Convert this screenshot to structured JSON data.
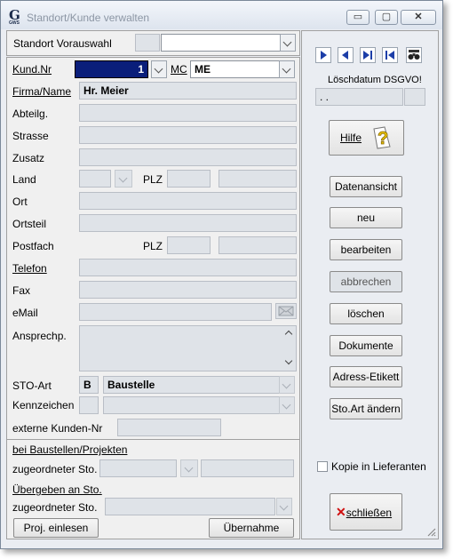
{
  "window": {
    "title": "Standort/Kunde verwalten",
    "app_logo": "G",
    "app_logo_sub": "GWS",
    "minimize_glyph": "▭",
    "maximize_glyph": "▢",
    "close_glyph": "✕"
  },
  "top": {
    "standort_label": "Standort Vorauswahl",
    "standort_code": "",
    "standort_value": ""
  },
  "form": {
    "kundnr_label": "Kund.Nr",
    "kundnr_value": "1",
    "mc_label": "MC",
    "mc_value": "ME",
    "firma_label": "Firma/Name",
    "firma_value": "Hr. Meier",
    "abteilg_label": "Abteilg.",
    "strasse_label": "Strasse",
    "zusatz_label": "Zusatz",
    "land_label": "Land",
    "plz_label": "PLZ",
    "ort_label": "Ort",
    "ortsteil_label": "Ortsteil",
    "postfach_label": "Postfach",
    "plz2_label": "PLZ",
    "telefon_label": "Telefon",
    "fax_label": "Fax",
    "email_label": "eMail",
    "ansprechp_label": "Ansprechp.",
    "stoart_label": "STO-Art",
    "stoart_code": "B",
    "stoart_value": "Baustelle",
    "kennzeichen_label": "Kennzeichen",
    "externe_label": "externe Kunden-Nr"
  },
  "baustellen": {
    "header": "bei Baustellen/Projekten",
    "zugeordneter1_label": "zugeordneter Sto.",
    "uebergeben_header": "Übergeben an Sto.",
    "zugeordneter2_label": "zugeordneter Sto.",
    "proj_button": "Proj. einlesen",
    "uebernahme_button": "Übernahme"
  },
  "side": {
    "loeschdatum_label": "Löschdatum DSGVO!",
    "loeschdatum_value": ". .",
    "hilfe_button": "Hilfe",
    "datenansicht_button": "Datenansicht",
    "neu_button": "neu",
    "bearbeiten_button": "bearbeiten",
    "abbrechen_button": "abbrechen",
    "loeschen_button": "löschen",
    "dokumente_button": "Dokumente",
    "adress_button": "Adress-Etikett",
    "stoart_button": "Sto.Art ändern",
    "kopie_label": "Kopie in Lieferanten",
    "kopie_checked": false,
    "schliessen_button": "schließen"
  },
  "colors": {
    "accent_nav": "#1c3ea8",
    "field_disabled": "#dfe3e8",
    "selected_field": "#0a1e7a"
  }
}
